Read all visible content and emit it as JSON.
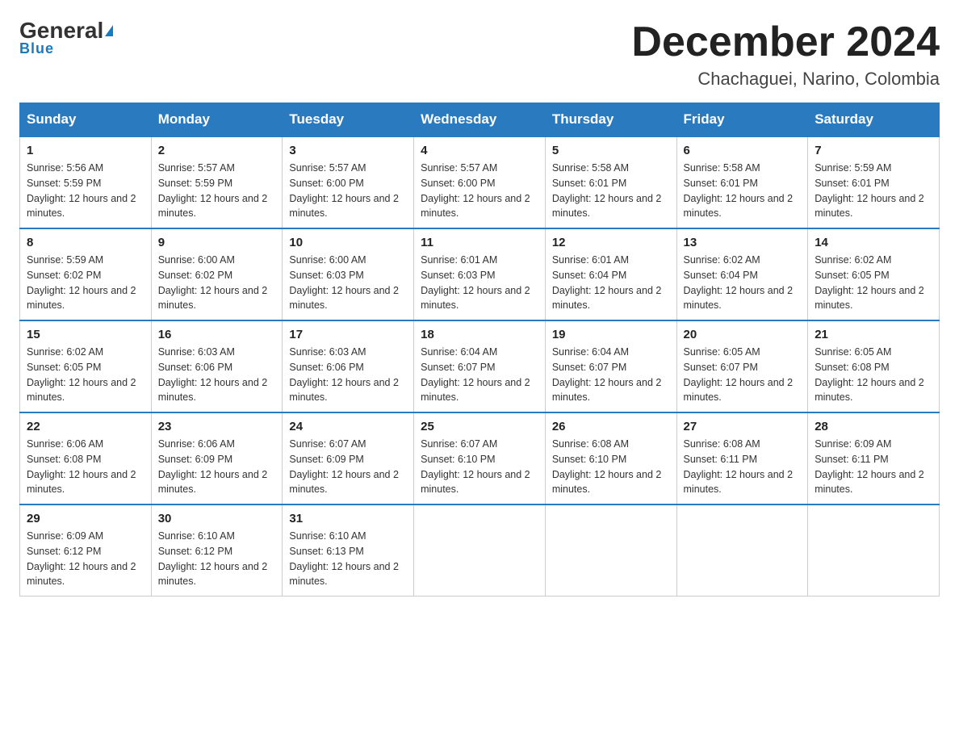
{
  "logo": {
    "text1": "General",
    "text2": "Blue"
  },
  "header": {
    "month": "December 2024",
    "location": "Chachaguei, Narino, Colombia"
  },
  "days_of_week": [
    "Sunday",
    "Monday",
    "Tuesday",
    "Wednesday",
    "Thursday",
    "Friday",
    "Saturday"
  ],
  "weeks": [
    [
      {
        "num": "1",
        "sunrise": "5:56 AM",
        "sunset": "5:59 PM",
        "daylight": "12 hours and 2 minutes."
      },
      {
        "num": "2",
        "sunrise": "5:57 AM",
        "sunset": "5:59 PM",
        "daylight": "12 hours and 2 minutes."
      },
      {
        "num": "3",
        "sunrise": "5:57 AM",
        "sunset": "6:00 PM",
        "daylight": "12 hours and 2 minutes."
      },
      {
        "num": "4",
        "sunrise": "5:57 AM",
        "sunset": "6:00 PM",
        "daylight": "12 hours and 2 minutes."
      },
      {
        "num": "5",
        "sunrise": "5:58 AM",
        "sunset": "6:01 PM",
        "daylight": "12 hours and 2 minutes."
      },
      {
        "num": "6",
        "sunrise": "5:58 AM",
        "sunset": "6:01 PM",
        "daylight": "12 hours and 2 minutes."
      },
      {
        "num": "7",
        "sunrise": "5:59 AM",
        "sunset": "6:01 PM",
        "daylight": "12 hours and 2 minutes."
      }
    ],
    [
      {
        "num": "8",
        "sunrise": "5:59 AM",
        "sunset": "6:02 PM",
        "daylight": "12 hours and 2 minutes."
      },
      {
        "num": "9",
        "sunrise": "6:00 AM",
        "sunset": "6:02 PM",
        "daylight": "12 hours and 2 minutes."
      },
      {
        "num": "10",
        "sunrise": "6:00 AM",
        "sunset": "6:03 PM",
        "daylight": "12 hours and 2 minutes."
      },
      {
        "num": "11",
        "sunrise": "6:01 AM",
        "sunset": "6:03 PM",
        "daylight": "12 hours and 2 minutes."
      },
      {
        "num": "12",
        "sunrise": "6:01 AM",
        "sunset": "6:04 PM",
        "daylight": "12 hours and 2 minutes."
      },
      {
        "num": "13",
        "sunrise": "6:02 AM",
        "sunset": "6:04 PM",
        "daylight": "12 hours and 2 minutes."
      },
      {
        "num": "14",
        "sunrise": "6:02 AM",
        "sunset": "6:05 PM",
        "daylight": "12 hours and 2 minutes."
      }
    ],
    [
      {
        "num": "15",
        "sunrise": "6:02 AM",
        "sunset": "6:05 PM",
        "daylight": "12 hours and 2 minutes."
      },
      {
        "num": "16",
        "sunrise": "6:03 AM",
        "sunset": "6:06 PM",
        "daylight": "12 hours and 2 minutes."
      },
      {
        "num": "17",
        "sunrise": "6:03 AM",
        "sunset": "6:06 PM",
        "daylight": "12 hours and 2 minutes."
      },
      {
        "num": "18",
        "sunrise": "6:04 AM",
        "sunset": "6:07 PM",
        "daylight": "12 hours and 2 minutes."
      },
      {
        "num": "19",
        "sunrise": "6:04 AM",
        "sunset": "6:07 PM",
        "daylight": "12 hours and 2 minutes."
      },
      {
        "num": "20",
        "sunrise": "6:05 AM",
        "sunset": "6:07 PM",
        "daylight": "12 hours and 2 minutes."
      },
      {
        "num": "21",
        "sunrise": "6:05 AM",
        "sunset": "6:08 PM",
        "daylight": "12 hours and 2 minutes."
      }
    ],
    [
      {
        "num": "22",
        "sunrise": "6:06 AM",
        "sunset": "6:08 PM",
        "daylight": "12 hours and 2 minutes."
      },
      {
        "num": "23",
        "sunrise": "6:06 AM",
        "sunset": "6:09 PM",
        "daylight": "12 hours and 2 minutes."
      },
      {
        "num": "24",
        "sunrise": "6:07 AM",
        "sunset": "6:09 PM",
        "daylight": "12 hours and 2 minutes."
      },
      {
        "num": "25",
        "sunrise": "6:07 AM",
        "sunset": "6:10 PM",
        "daylight": "12 hours and 2 minutes."
      },
      {
        "num": "26",
        "sunrise": "6:08 AM",
        "sunset": "6:10 PM",
        "daylight": "12 hours and 2 minutes."
      },
      {
        "num": "27",
        "sunrise": "6:08 AM",
        "sunset": "6:11 PM",
        "daylight": "12 hours and 2 minutes."
      },
      {
        "num": "28",
        "sunrise": "6:09 AM",
        "sunset": "6:11 PM",
        "daylight": "12 hours and 2 minutes."
      }
    ],
    [
      {
        "num": "29",
        "sunrise": "6:09 AM",
        "sunset": "6:12 PM",
        "daylight": "12 hours and 2 minutes."
      },
      {
        "num": "30",
        "sunrise": "6:10 AM",
        "sunset": "6:12 PM",
        "daylight": "12 hours and 2 minutes."
      },
      {
        "num": "31",
        "sunrise": "6:10 AM",
        "sunset": "6:13 PM",
        "daylight": "12 hours and 2 minutes."
      },
      null,
      null,
      null,
      null
    ]
  ]
}
